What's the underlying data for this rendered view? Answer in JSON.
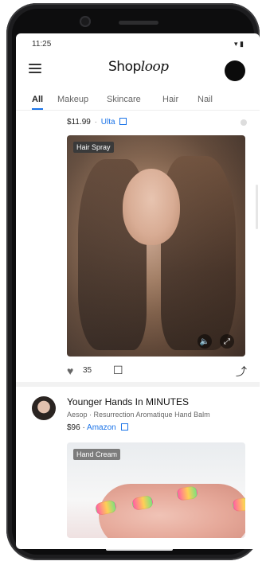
{
  "status": {
    "time": "11:25",
    "signal": "▾ ▮"
  },
  "header": {
    "logo_prefix": "Shop",
    "logo_suffix": "loop"
  },
  "tabs": [
    "All",
    "Makeup",
    "Skincare",
    "Hair",
    "Nail"
  ],
  "card1": {
    "price": "$11.99",
    "store": "Ulta",
    "tag": "Hair Spray",
    "likes": "35"
  },
  "card2": {
    "title": "Younger Hands In MINUTES",
    "subtitle": "Aesop · Resurrection Aromatique Hand Balm",
    "price": "$96",
    "store": "Amazon",
    "tag": "Hand Cream"
  },
  "colors": {
    "accent": "#1a73e8",
    "divider": "#f2f2f2",
    "text": "#222222"
  },
  "icons": {
    "menu": "hamburger-icon",
    "external": "external-link-icon",
    "like": "heart-icon",
    "save": "bookmark-icon",
    "share": "share-icon",
    "sound": "sound-icon",
    "fullscreen": "fullscreen-icon"
  }
}
